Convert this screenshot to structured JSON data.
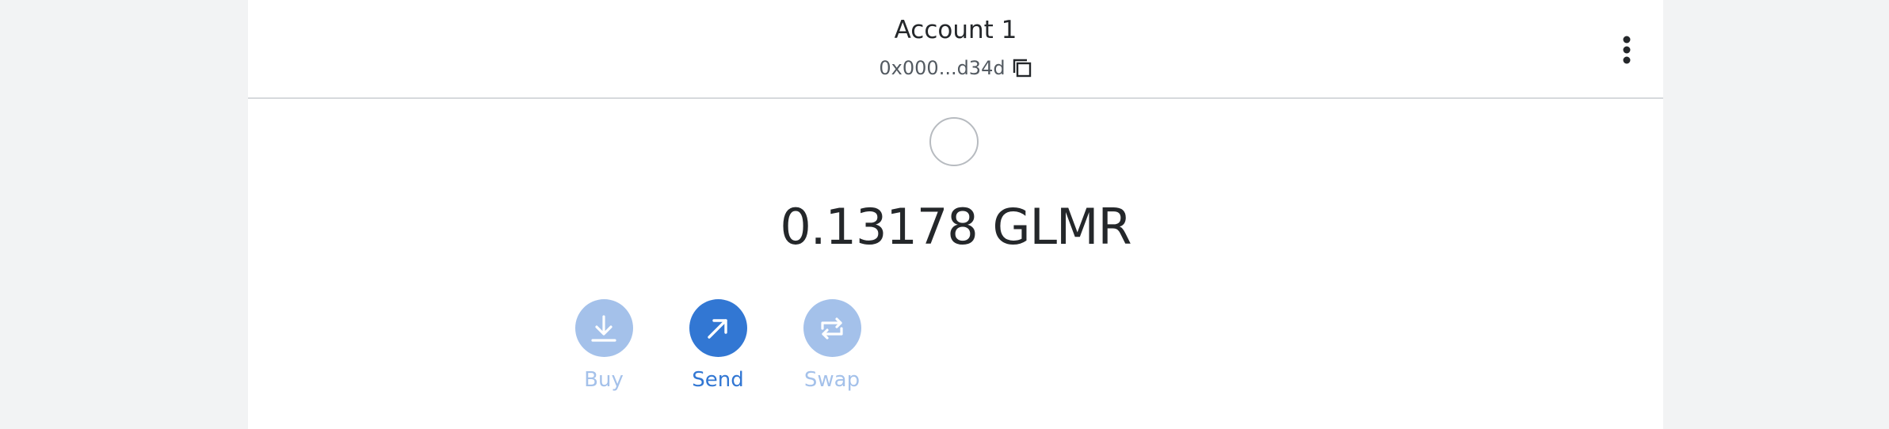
{
  "header": {
    "account_name": "Account 1",
    "address": "0x000...d34d"
  },
  "balance": {
    "amount": "0.13178 GLMR"
  },
  "actions": [
    {
      "label": "Buy",
      "icon": "download-icon",
      "enabled": false
    },
    {
      "label": "Send",
      "icon": "arrow-up-right-icon",
      "enabled": true
    },
    {
      "label": "Swap",
      "icon": "swap-arrows-icon",
      "enabled": false
    }
  ],
  "colors": {
    "page_background": "#f2f3f4",
    "panel_background": "#ffffff",
    "primary": "#3277d3",
    "disabled": "#a4c1ea",
    "text_dark": "#24272a",
    "text_muted": "#535a61",
    "divider": "#d6d9dc"
  }
}
